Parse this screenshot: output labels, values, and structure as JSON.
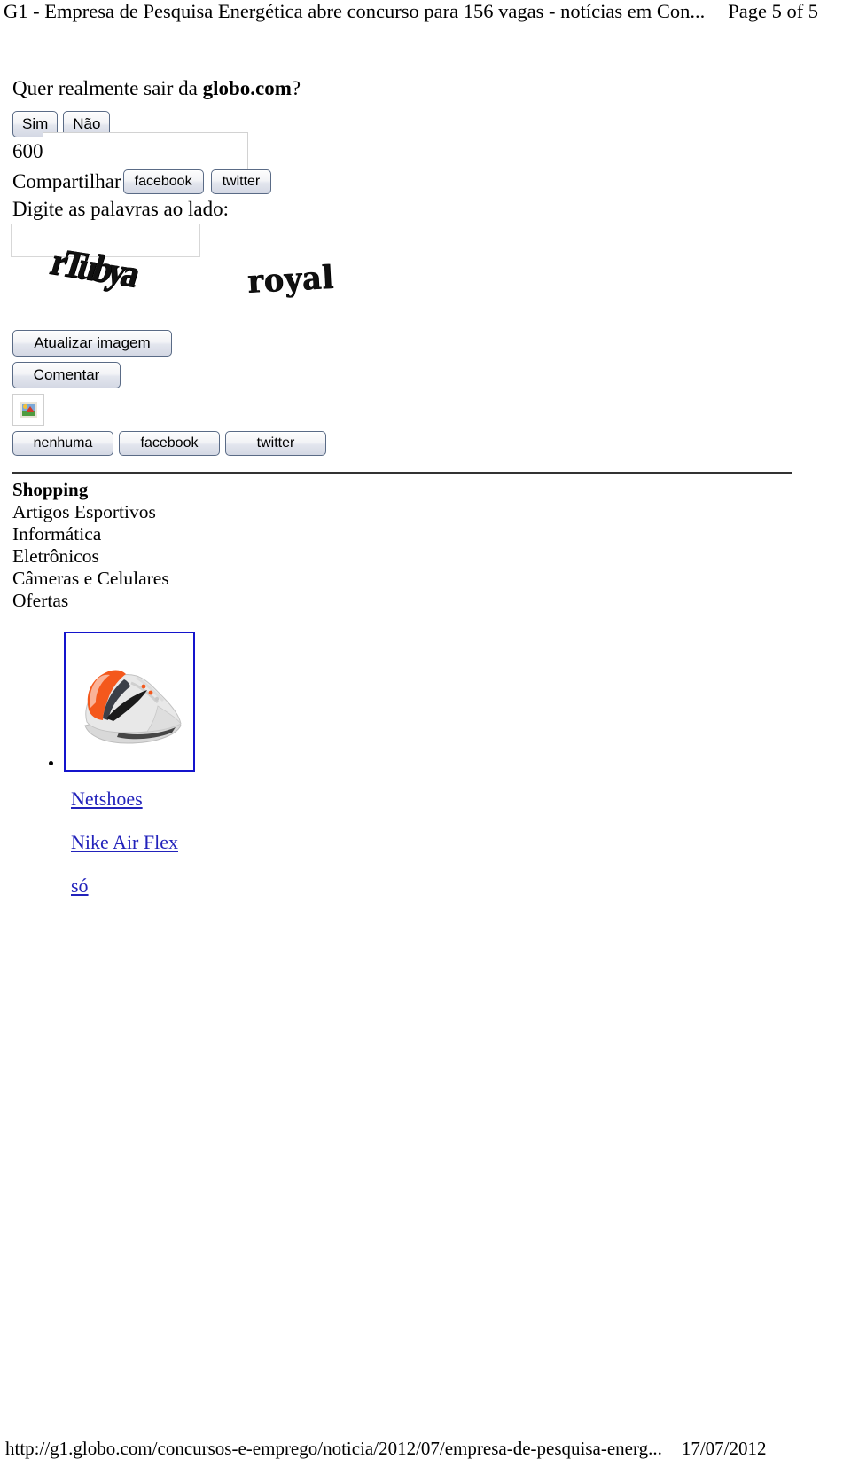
{
  "header": {
    "doc_title": "G1 - Empresa de Pesquisa Energética abre concurso para 156 vagas - notícias em Con...",
    "page_label": "Page 5 of 5"
  },
  "dialog": {
    "question_prefix": "Quer realmente sair da ",
    "question_domain": "globo.com",
    "question_suffix": "?",
    "yes_label": "Sim",
    "no_label": "Não"
  },
  "comment_form": {
    "char_counter": "600",
    "comment_textarea_value": "",
    "comment_textarea_placeholder": "",
    "share_label": "Compartilhar",
    "share_facebook_label": "facebook",
    "share_twitter_label": "twitter",
    "captcha_label": "Digite as palavras ao lado:",
    "captcha_input_value": "",
    "captcha_input_placeholder": "",
    "captcha_word_1": "rTubya",
    "captcha_word_2": "royal",
    "refresh_label": "Atualizar imagem",
    "submit_label": "Comentar",
    "broken_image_alt": "broken-image-placeholder",
    "post_to_none_label": "nenhuma",
    "post_to_facebook_label": "facebook",
    "post_to_twitter_label": "twitter"
  },
  "shopping": {
    "title": "Shopping",
    "categories": [
      "Artigos Esportivos",
      "Informática",
      "Eletrônicos",
      "Câmeras e Celulares",
      "Ofertas"
    ],
    "products": [
      {
        "image_alt": "nike-running-shoe",
        "store_link": "Netshoes",
        "product_link": "Nike Air Flex",
        "price_link": "só"
      }
    ]
  },
  "footer": {
    "url": "http://g1.globo.com/concursos-e-emprego/noticia/2012/07/empresa-de-pesquisa-energ...",
    "date": "17/07/2012"
  },
  "colors": {
    "link": "#2222bb",
    "thumb_border": "#1414cc",
    "rule": "#333333",
    "button_border": "#5a6b86"
  }
}
